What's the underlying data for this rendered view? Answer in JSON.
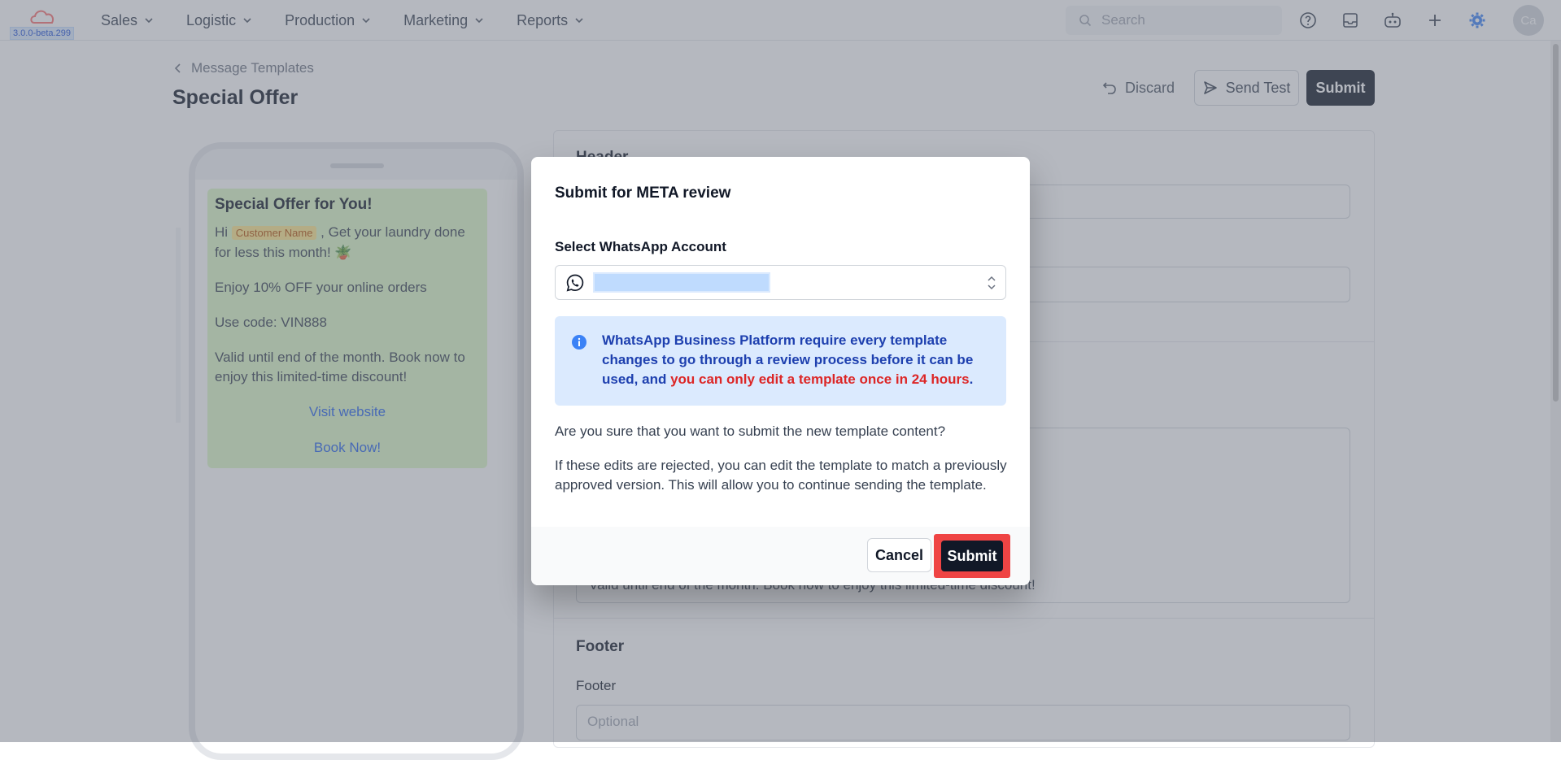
{
  "app": {
    "version": "3.0.0-beta.299"
  },
  "nav": {
    "items": [
      {
        "label": "Sales"
      },
      {
        "label": "Logistic"
      },
      {
        "label": "Production"
      },
      {
        "label": "Marketing"
      },
      {
        "label": "Reports"
      }
    ],
    "search_placeholder": "Search",
    "avatar_initials": "Ca",
    "accent_color": "#3b82f6"
  },
  "page": {
    "breadcrumb": "Message Templates",
    "title": "Special Offer",
    "actions": {
      "discard": "Discard",
      "send_test": "Send Test",
      "submit": "Submit"
    }
  },
  "preview": {
    "title": "Special Offer for You!",
    "greeting_prefix": "Hi",
    "variable_chip": "Customer Name",
    "greeting_suffix": ", Get your laundry done for less this month! 🪴",
    "line_discount": "Enjoy 10% OFF your online orders",
    "line_code": "Use code: VIN888",
    "line_valid": "Valid until end of the month. Book now to enjoy this limited-time discount!",
    "button_1": "Visit website",
    "button_2": "Book Now!"
  },
  "form": {
    "header_title": "Header",
    "body_last_line": "Valid until end of the month. Book now to enjoy this limited-time discount!",
    "footer_title": "Footer",
    "footer_label": "Footer",
    "footer_placeholder": "Optional"
  },
  "modal": {
    "title": "Submit for META review",
    "account_label": "Select WhatsApp Account",
    "info_text": "WhatsApp Business Platform require every template changes to go through a review process before it can be used, and ",
    "info_highlight": "you can only edit a template once in 24 hours",
    "info_end": ".",
    "question": "Are you sure that you want to submit the new template content?",
    "note": "If these edits are rejected, you can edit the template to match a previously approved version. This will allow you to continue sending the template.",
    "cancel_label": "Cancel",
    "submit_label": "Submit",
    "highlight_color": "#ef4444"
  }
}
